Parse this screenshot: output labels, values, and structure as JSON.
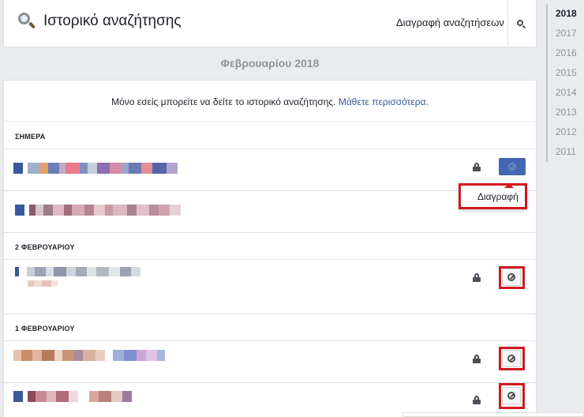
{
  "header": {
    "title": "Ιστορικό αναζήτησης",
    "clear_label": "Διαγραφή αναζητήσεων"
  },
  "month_title": "Φεβρουαρίου 2018",
  "notice": {
    "text": "Μόνο εσείς μπορείτε να δείτε το ιστορικό αναζήτησης.",
    "link": "Μάθετε περισσότερα."
  },
  "sections": [
    {
      "heading": "ΣΗΜΕΡΑ"
    },
    {
      "heading": "2 ΦΕΒΡΟΥΑΡΙΟΥ"
    },
    {
      "heading": "1 ΦΕΒΡΟΥΑΡΙΟΥ"
    }
  ],
  "tooltip": {
    "label": "Διαγραφή"
  },
  "years": [
    "2018",
    "2017",
    "2016",
    "2015",
    "2014",
    "2013",
    "2012",
    "2011"
  ],
  "icons": {
    "search": "magnifier-icon",
    "lock": "lock-icon",
    "delete": "no-entry-icon"
  },
  "colors": {
    "link": "#365899",
    "highlight": "#d0191f",
    "button_active": "#4267b2"
  }
}
